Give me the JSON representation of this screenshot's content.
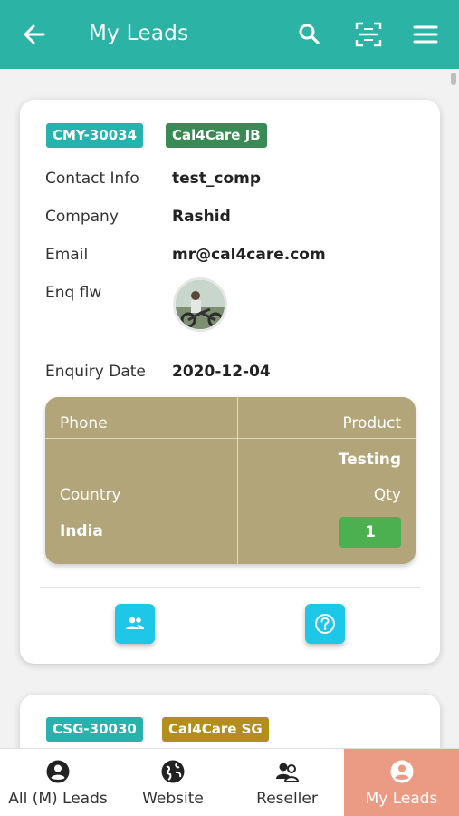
{
  "appbar": {
    "title": "My Leads",
    "back_icon": "arrow-left-icon",
    "search_icon": "search-icon",
    "scan_icon": "qr-scan-icon",
    "menu_icon": "menu-icon",
    "color": "#2bb3a6"
  },
  "leads": [
    {
      "id_tag": "CMY-30034",
      "company_tag": "Cal4Care JB",
      "fields": {
        "contact_label": "Contact Info",
        "contact_value": "test_comp",
        "company_label": "Company",
        "company_value": "Rashid",
        "email_label": "Email",
        "email_value": "mr@cal4care.com",
        "enq_label": "Enq flw",
        "date_label": "Enquiry Date",
        "date_value": "2020-12-04"
      },
      "detail": {
        "phone_label": "Phone",
        "product_label": "Product",
        "product_value": "Testing",
        "country_label": "Country",
        "qty_label": "Qty",
        "country_value": "India",
        "qty_value": "1"
      },
      "actions": [
        "users-icon",
        "help-icon"
      ]
    },
    {
      "id_tag": "CSG-30030",
      "company_tag": "Cal4Care SG"
    }
  ],
  "bottom_nav": [
    {
      "label": "All (M) Leads",
      "icon": "account-circle-icon"
    },
    {
      "label": "Website",
      "icon": "globe-icon"
    },
    {
      "label": "Reseller",
      "icon": "group-icon"
    },
    {
      "label": "My Leads",
      "icon": "account-circle-icon",
      "active": true
    }
  ]
}
